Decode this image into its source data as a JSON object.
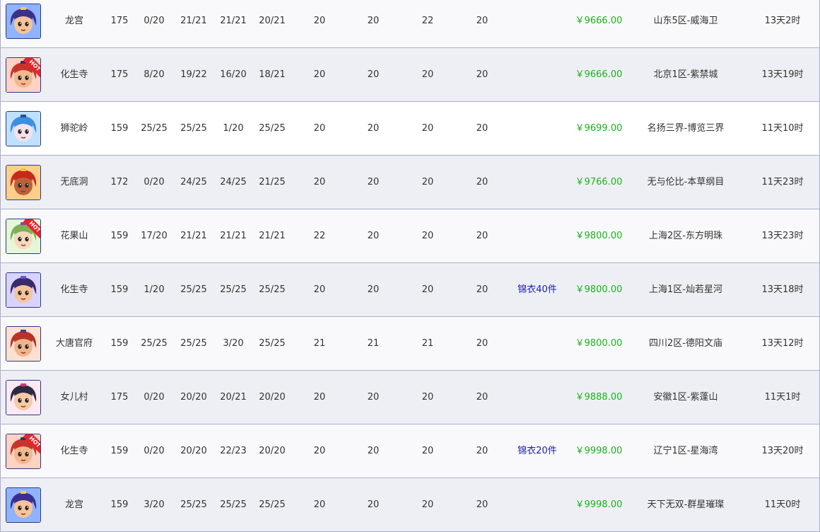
{
  "currency_symbol": "￥",
  "colors": {
    "price": "#18b418",
    "extra": "#1b21a8",
    "row_border": "#a9aed0"
  },
  "rows": [
    {
      "avatar": "dragon-palace-male",
      "hot": false,
      "sect": "龙宫",
      "level": "175",
      "s1": "0/20",
      "s2": "21/21",
      "s3": "21/21",
      "s4": "20/21",
      "c1": "20",
      "c2": "20",
      "c3": "22",
      "c4": "20",
      "extra": "",
      "price": "9666.00",
      "server": "山东5区-威海卫",
      "time": "13天2时"
    },
    {
      "avatar": "huasheng-red-hair",
      "hot": true,
      "hot_label": "HOT",
      "sect": "化生寺",
      "level": "175",
      "s1": "8/20",
      "s2": "19/22",
      "s3": "16/20",
      "s4": "18/21",
      "c1": "20",
      "c2": "20",
      "c3": "20",
      "c4": "20",
      "extra": "",
      "price": "9666.00",
      "server": "北京1区-紫禁城",
      "time": "13天19时"
    },
    {
      "avatar": "shituo-blue-hair",
      "hot": false,
      "sect": "狮驼岭",
      "level": "159",
      "s1": "25/25",
      "s2": "25/25",
      "s3": "1/20",
      "s4": "25/25",
      "c1": "20",
      "c2": "20",
      "c3": "20",
      "c4": "20",
      "extra": "",
      "price": "9699.00",
      "server": "名扬三界-博览三界",
      "time": "11天10时"
    },
    {
      "avatar": "wudidong-demon",
      "hot": false,
      "sect": "无底洞",
      "level": "172",
      "s1": "0/20",
      "s2": "24/25",
      "s3": "24/25",
      "s4": "21/25",
      "c1": "20",
      "c2": "20",
      "c3": "20",
      "c4": "20",
      "extra": "",
      "price": "9766.00",
      "server": "无与伦比-本草纲目",
      "time": "11天23时"
    },
    {
      "avatar": "huaguoshan-green-girl",
      "hot": true,
      "hot_label": "HOT",
      "sect": "花果山",
      "level": "159",
      "s1": "17/20",
      "s2": "21/21",
      "s3": "21/21",
      "s4": "21/21",
      "c1": "22",
      "c2": "20",
      "c3": "20",
      "c4": "20",
      "extra": "",
      "price": "9800.00",
      "server": "上海2区-东方明珠",
      "time": "13天23时"
    },
    {
      "avatar": "huasheng-dark-hair",
      "hot": false,
      "sect": "化生寺",
      "level": "159",
      "s1": "1/20",
      "s2": "25/25",
      "s3": "25/25",
      "s4": "25/25",
      "c1": "20",
      "c2": "20",
      "c3": "20",
      "c4": "20",
      "extra": "锦衣40件",
      "price": "9800.00",
      "server": "上海1区-灿若星河",
      "time": "13天18时"
    },
    {
      "avatar": "datang-red-hair",
      "hot": false,
      "sect": "大唐官府",
      "level": "159",
      "s1": "25/25",
      "s2": "25/25",
      "s3": "3/20",
      "s4": "25/25",
      "c1": "21",
      "c2": "21",
      "c3": "21",
      "c4": "20",
      "extra": "",
      "price": "9800.00",
      "server": "四川2区-德阳文庙",
      "time": "13天12时"
    },
    {
      "avatar": "nverguo-girl",
      "hot": false,
      "sect": "女儿村",
      "level": "175",
      "s1": "0/20",
      "s2": "20/20",
      "s3": "20/21",
      "s4": "20/20",
      "c1": "20",
      "c2": "20",
      "c3": "20",
      "c4": "20",
      "extra": "",
      "price": "9888.00",
      "server": "安徽1区-紫蓬山",
      "time": "11天1时"
    },
    {
      "avatar": "huasheng-red-hair",
      "hot": true,
      "hot_label": "HOT",
      "sect": "化生寺",
      "level": "159",
      "s1": "0/20",
      "s2": "20/20",
      "s3": "22/23",
      "s4": "20/20",
      "c1": "20",
      "c2": "20",
      "c3": "20",
      "c4": "20",
      "extra": "锦衣20件",
      "price": "9998.00",
      "server": "辽宁1区-星海湾",
      "time": "13天20时"
    },
    {
      "avatar": "dragon-palace-male",
      "hot": false,
      "sect": "龙宫",
      "level": "159",
      "s1": "3/20",
      "s2": "25/25",
      "s3": "25/25",
      "s4": "25/25",
      "c1": "20",
      "c2": "20",
      "c3": "20",
      "c4": "20",
      "extra": "",
      "price": "9998.00",
      "server": "天下无双-群星璀璨",
      "time": "11天0时"
    }
  ]
}
